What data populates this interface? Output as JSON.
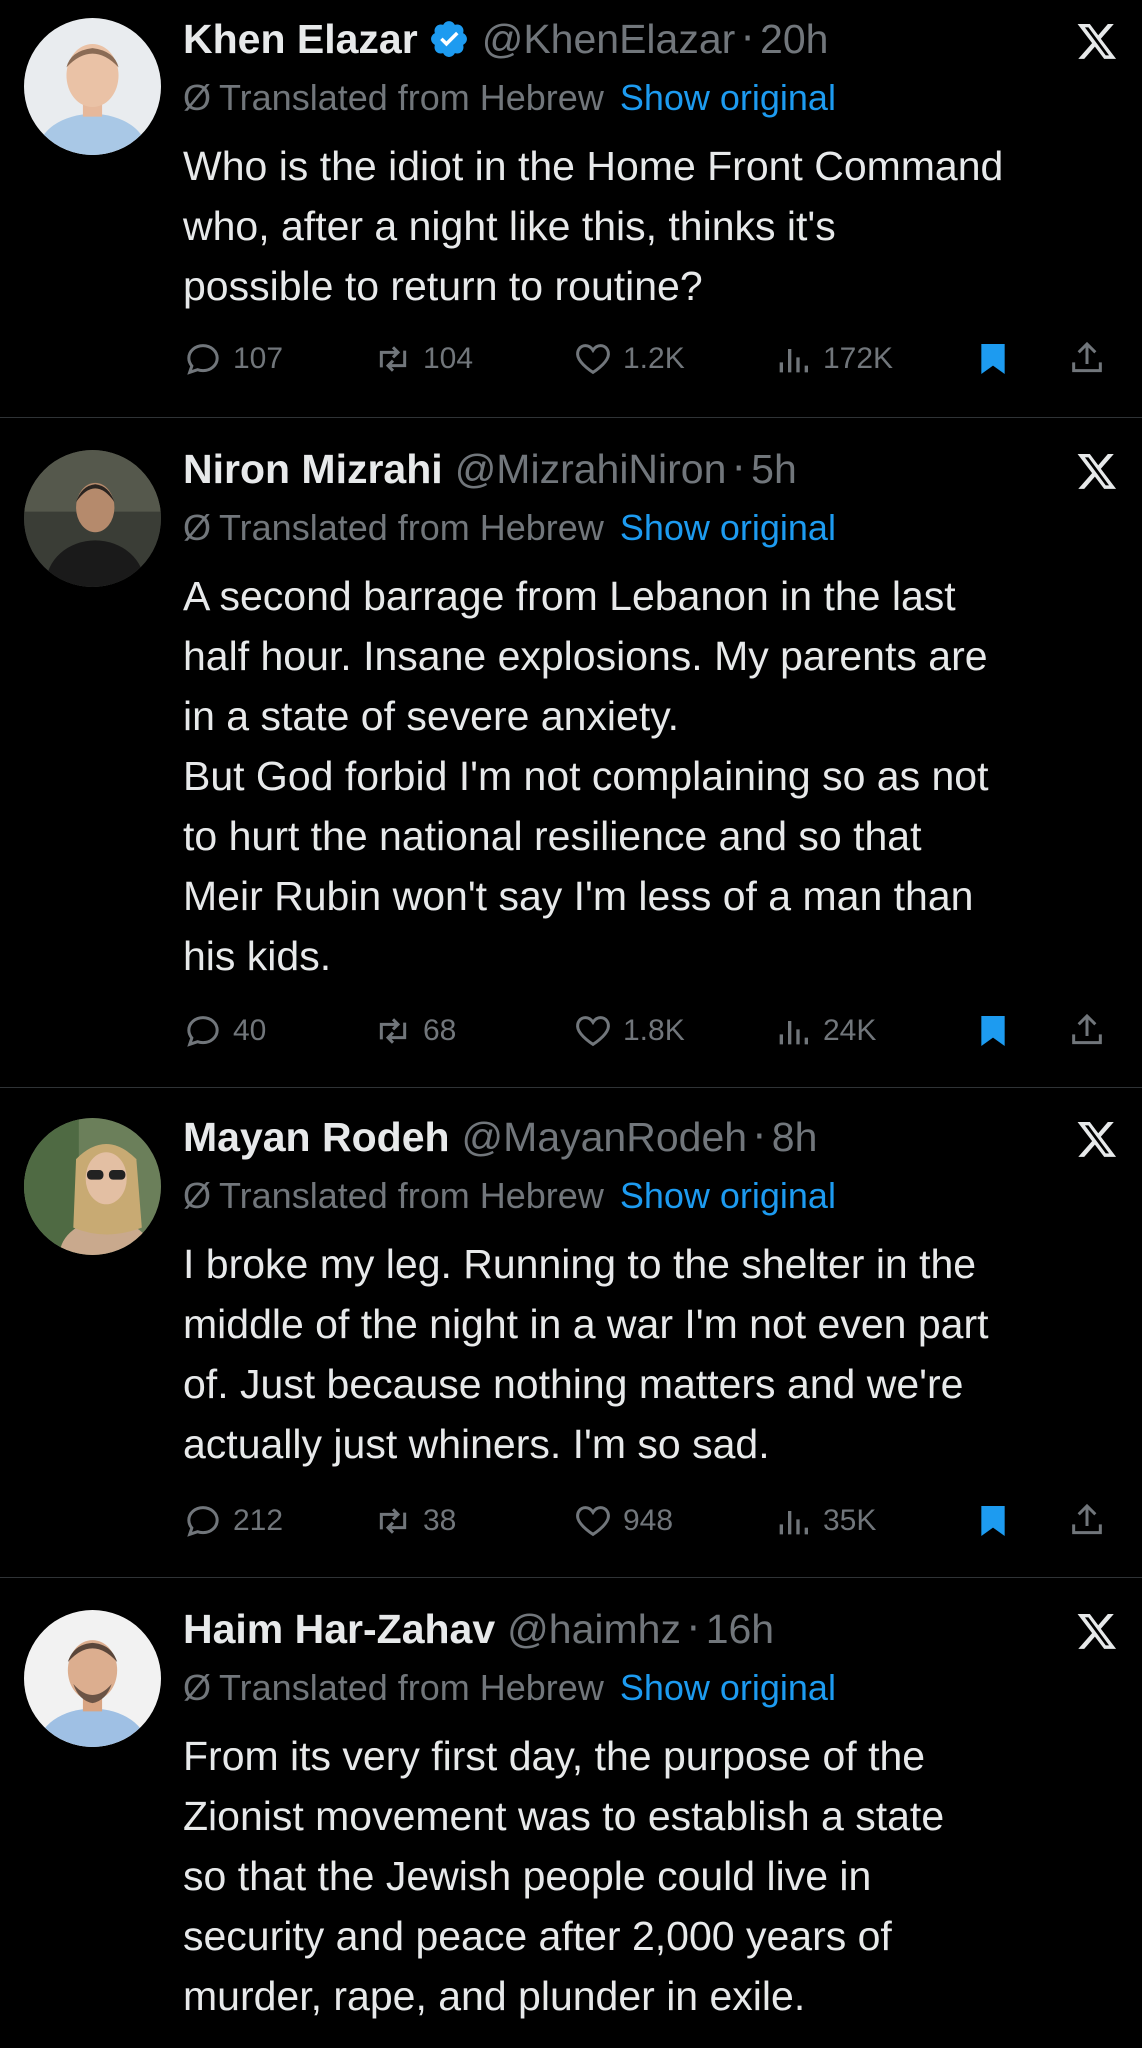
{
  "tweets": [
    {
      "name": "Khen Elazar",
      "verified": true,
      "handle": "@KhenElazar",
      "time": "20h",
      "translated_label": "Translated from Hebrew",
      "show_original": "Show original",
      "lines": [
        "Who is the idiot in the Home Front Command",
        "who, after a night like this, thinks it's",
        "possible to return to routine?"
      ],
      "replies": "107",
      "retweets": "104",
      "likes": "1.2K",
      "views": "172K",
      "avatar": "man-light-shirt"
    },
    {
      "name": "Niron Mizrahi",
      "verified": false,
      "handle": "@MizrahiNiron",
      "time": "5h",
      "translated_label": "Translated from Hebrew",
      "show_original": "Show original",
      "lines": [
        "A second barrage from Lebanon in the last",
        "half hour. Insane explosions. My parents are",
        "in a state of severe anxiety.",
        "But God forbid I'm not complaining so as not",
        "to hurt the national resilience and so that",
        "Meir Rubin won't say I'm less of a man than",
        "his kids."
      ],
      "replies": "40",
      "retweets": "68",
      "likes": "1.8K",
      "views": "24K",
      "avatar": "man-dark-jacket"
    },
    {
      "name": "Mayan Rodeh",
      "verified": false,
      "handle": "@MayanRodeh",
      "time": "8h",
      "translated_label": "Translated from Hebrew",
      "show_original": "Show original",
      "lines": [
        "I broke my leg. Running to the shelter in the",
        "middle of the night in a war I'm not even part",
        "of. Just because nothing matters and we're",
        "actually just whiners. I'm so sad."
      ],
      "replies": "212",
      "retweets": "38",
      "likes": "948",
      "views": "35K",
      "avatar": "woman-sunglasses"
    },
    {
      "name": "Haim Har-Zahav",
      "verified": false,
      "handle": "@haimhz",
      "time": "16h",
      "translated_label": "Translated from Hebrew",
      "show_original": "Show original",
      "lines": [
        "From its very first day, the purpose of the",
        "Zionist movement was to establish a state",
        "so that the Jewish people could live in",
        "security and peace after 2,000 years of",
        "murder, rape, and plunder in exile."
      ],
      "avatar": "man-blue-shirt"
    }
  ],
  "icons": {
    "reply": "reply-icon",
    "retweet": "retweet-icon",
    "like": "heart-icon",
    "views": "views-icon",
    "bookmark": "bookmark-icon",
    "share": "share-icon",
    "verified": "verified-badge-icon",
    "x_logo": "x-logo-icon",
    "translate": "translate-icon"
  },
  "colors": {
    "background": "#000000",
    "text": "#e7e9ea",
    "muted": "#71767b",
    "link": "#1d9bf0",
    "bookmark": "#1d9bf0",
    "divider": "#2f3336"
  }
}
